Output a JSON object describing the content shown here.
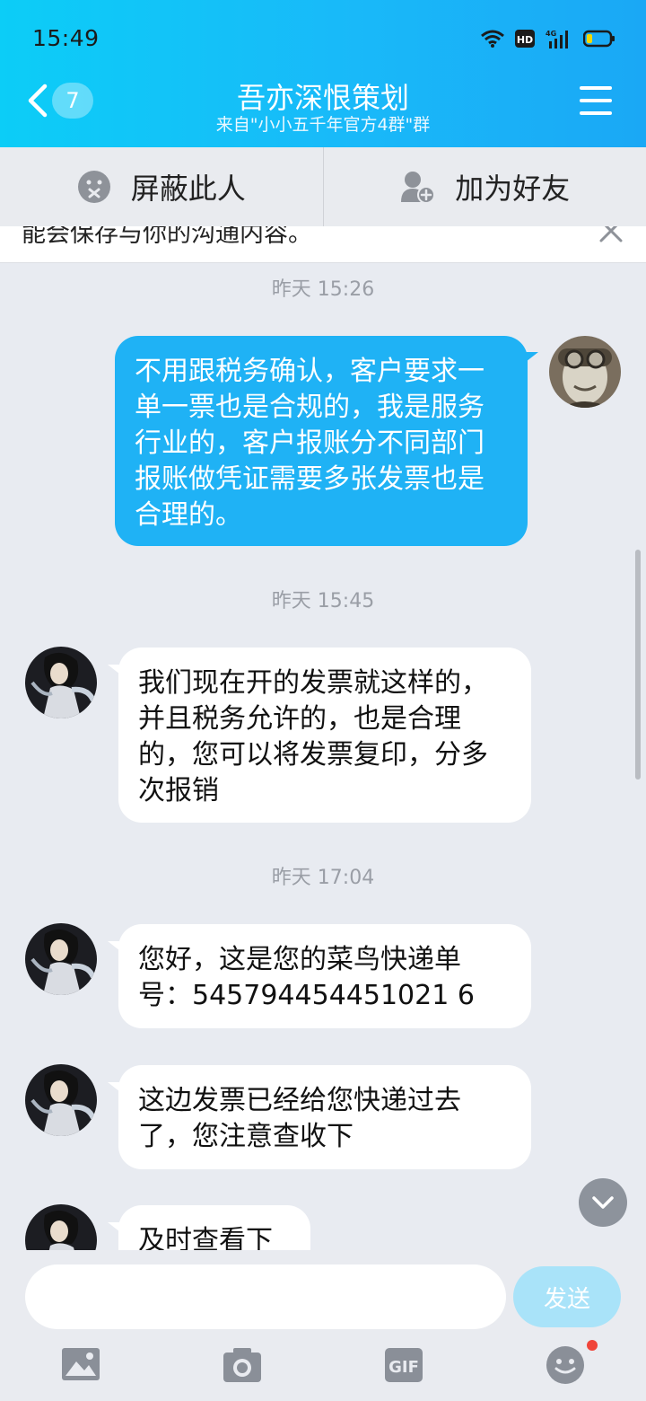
{
  "status_bar": {
    "time": "15:49"
  },
  "header": {
    "back_badge": "7",
    "title": "吾亦深恨策划",
    "subtitle": "来自\"小小五千年官方4群\"群"
  },
  "actions": {
    "block_label": "屏蔽此人",
    "add_friend_label": "加为好友"
  },
  "notice": {
    "text": "能会保存与你的沟通内容。"
  },
  "messages": [
    {
      "type": "timestamp",
      "text": "昨天 15:26"
    },
    {
      "type": "outgoing",
      "text": "不用跟税务确认，客户要求一单一票也是合规的，我是服务行业的，客户报账分不同部门报账做凭证需要多张发票也是合理的。"
    },
    {
      "type": "timestamp",
      "text": "昨天 15:45"
    },
    {
      "type": "incoming",
      "text": "我们现在开的发票就这样的，并且税务允许的，也是合理的，您可以将发票复印，分多次报销"
    },
    {
      "type": "timestamp",
      "text": "昨天 17:04"
    },
    {
      "type": "incoming",
      "text": "您好，这是您的菜鸟快递单号：545794454451021 6"
    },
    {
      "type": "incoming",
      "text": "这边发票已经给您快递过去了，您注意查收下"
    },
    {
      "type": "incoming",
      "text": "及时查看下"
    }
  ],
  "composer": {
    "input_value": "",
    "send_label": "发送"
  },
  "toolbar": {
    "icons": [
      "image-icon",
      "camera-icon",
      "gif-icon",
      "emoji-icon"
    ],
    "gif_label": "GIF"
  },
  "colors": {
    "header_start": "#0ccdf7",
    "header_end": "#1aa8f5",
    "outgoing_bubble": "#1fb2f5",
    "incoming_bubble": "#ffffff",
    "background": "#e8ebf1",
    "notification_dot": "#f0453a"
  }
}
